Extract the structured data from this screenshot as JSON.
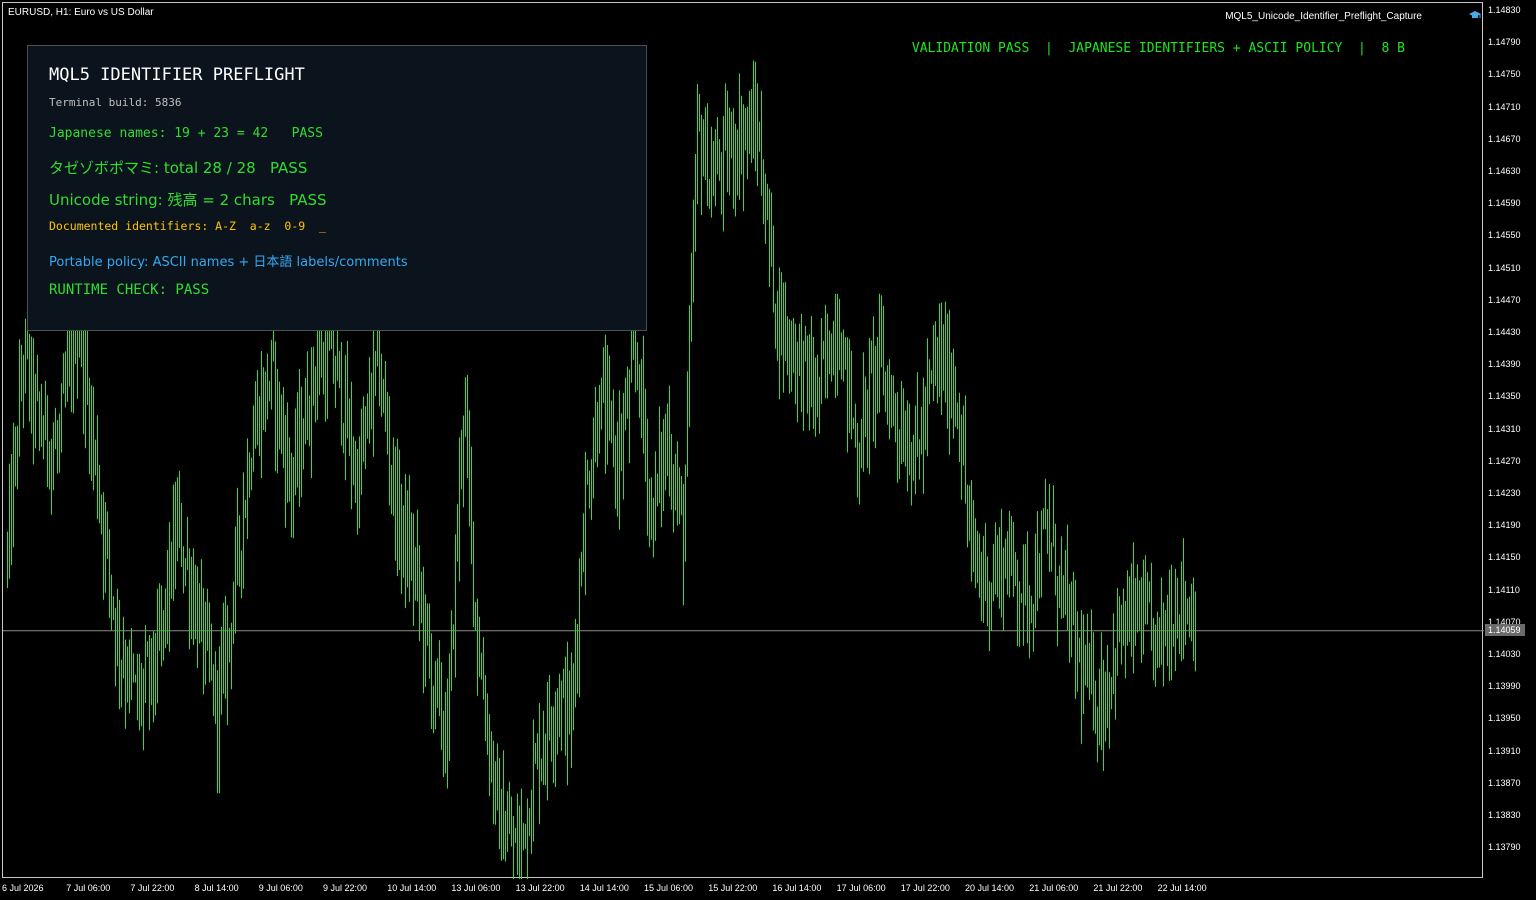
{
  "chart_header": {
    "symbol_line": "EURUSD, H1:  Euro vs US Dollar",
    "program_name": "MQL5_Unicode_Identifier_Preflight_Capture"
  },
  "status_line": "VALIDATION PASS  |  JAPANESE IDENTIFIERS + ASCII POLICY  |  8 B",
  "panel": {
    "title": "MQL5 IDENTIFIER PREFLIGHT",
    "build": "Terminal build: 5836",
    "line_japanese_names": "Japanese names: 19 + 23 = 42   PASS",
    "line_katakana_total": "タゼゾボポマミ: total 28 / 28   PASS",
    "line_unicode_string": "Unicode string: 残高 = 2 chars   PASS",
    "line_documented": "Documented identifiers: A-Z  a-z  0-9  _",
    "line_policy": "Portable policy: ASCII names + 日本語 labels/comments",
    "line_runtime": "RUNTIME CHECK: PASS"
  },
  "price_axis": {
    "labels": [
      "1.14830",
      "1.14790",
      "1.14750",
      "1.14710",
      "1.14670",
      "1.14630",
      "1.14590",
      "1.14550",
      "1.14510",
      "1.14470",
      "1.14430",
      "1.14390",
      "1.14350",
      "1.14310",
      "1.14270",
      "1.14230",
      "1.14190",
      "1.14150",
      "1.14110",
      "1.14070",
      "1.14030",
      "1.13990",
      "1.13950",
      "1.13910",
      "1.13870",
      "1.13830",
      "1.13790"
    ],
    "current_price": "1.14059"
  },
  "time_axis": {
    "labels": [
      "6 Jul 2026",
      "7 Jul 06:00",
      "7 Jul 22:00",
      "8 Jul 14:00",
      "9 Jul 06:00",
      "9 Jul 22:00",
      "10 Jul 14:00",
      "13 Jul 06:00",
      "13 Jul 22:00",
      "14 Jul 14:00",
      "15 Jul 06:00",
      "15 Jul 22:00",
      "16 Jul 14:00",
      "17 Jul 06:00",
      "17 Jul 22:00",
      "20 Jul 14:00",
      "21 Jul 06:00",
      "21 Jul 22:00",
      "22 Jul 14:00"
    ]
  },
  "colors": {
    "candle": "#2ce02c",
    "background": "#000000",
    "bid_line": "#8c8c8c"
  },
  "chart_data": {
    "type": "candlestick",
    "symbol": "EURUSD",
    "timeframe": "H1",
    "ylim": [
      1.1375,
      1.1484
    ],
    "current_price": 1.14059,
    "anchors": [
      [
        0,
        1.1415
      ],
      [
        8,
        1.144
      ],
      [
        15,
        1.1432
      ],
      [
        25,
        1.1428
      ],
      [
        35,
        1.1445
      ],
      [
        45,
        1.1425
      ],
      [
        55,
        1.1405
      ],
      [
        65,
        1.1397
      ],
      [
        75,
        1.1402
      ],
      [
        85,
        1.1419
      ],
      [
        95,
        1.1408
      ],
      [
        105,
        1.1396
      ],
      [
        112,
        1.1408
      ],
      [
        122,
        1.143
      ],
      [
        132,
        1.1438
      ],
      [
        142,
        1.1424
      ],
      [
        155,
        1.144
      ],
      [
        165,
        1.1438
      ],
      [
        175,
        1.1424
      ],
      [
        185,
        1.144
      ],
      [
        195,
        1.142
      ],
      [
        205,
        1.1412
      ],
      [
        212,
        1.14
      ],
      [
        220,
        1.1392
      ],
      [
        228,
        1.1435
      ],
      [
        235,
        1.1405
      ],
      [
        245,
        1.1383
      ],
      [
        255,
        1.1378
      ],
      [
        265,
        1.139
      ],
      [
        275,
        1.1398
      ],
      [
        282,
        1.1395
      ],
      [
        288,
        1.142
      ],
      [
        296,
        1.1435
      ],
      [
        305,
        1.1427
      ],
      [
        315,
        1.144
      ],
      [
        322,
        1.142
      ],
      [
        330,
        1.143
      ],
      [
        338,
        1.1418
      ],
      [
        345,
        1.1468
      ],
      [
        352,
        1.1462
      ],
      [
        360,
        1.1465
      ],
      [
        368,
        1.1468
      ],
      [
        375,
        1.1468
      ],
      [
        385,
        1.1445
      ],
      [
        395,
        1.144
      ],
      [
        405,
        1.1435
      ],
      [
        415,
        1.1445
      ],
      [
        425,
        1.1428
      ],
      [
        435,
        1.144
      ],
      [
        445,
        1.1432
      ],
      [
        455,
        1.1428
      ],
      [
        465,
        1.144
      ],
      [
        475,
        1.1435
      ],
      [
        482,
        1.1415
      ],
      [
        490,
        1.1412
      ],
      [
        500,
        1.1415
      ],
      [
        510,
        1.141
      ],
      [
        520,
        1.1418
      ],
      [
        528,
        1.141
      ],
      [
        538,
        1.14
      ],
      [
        548,
        1.1397
      ],
      [
        555,
        1.1405
      ],
      [
        565,
        1.1408
      ],
      [
        575,
        1.1404
      ],
      [
        585,
        1.141
      ],
      [
        594,
        1.1408
      ]
    ]
  }
}
